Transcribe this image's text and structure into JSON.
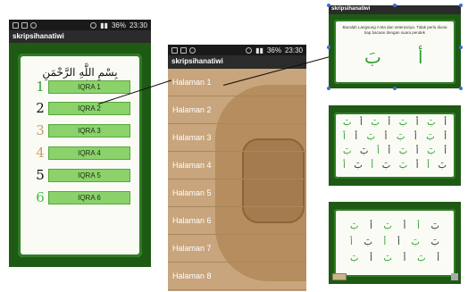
{
  "statusbar": {
    "battery": "36%",
    "time": "23:30"
  },
  "app_title": "skripsihanatiwi",
  "phone1": {
    "basmala": "بِسْمِ اللَّهِ الرَّحْمَنِ الرَّحِيمِ",
    "items": [
      {
        "num": "1",
        "label": "IQRA 1",
        "color": "#2f9e2f"
      },
      {
        "num": "2",
        "label": "IQRA 2",
        "color": "#111111"
      },
      {
        "num": "3",
        "label": "IQRA 3",
        "color": "#c8a066"
      },
      {
        "num": "4",
        "label": "IQRA 4",
        "color": "#c8a066"
      },
      {
        "num": "5",
        "label": "IQRA 5",
        "color": "#111111"
      },
      {
        "num": "6",
        "label": "IQRA 6",
        "color": "#3fbf3f"
      }
    ]
  },
  "phone2": {
    "items": [
      "Halaman 1",
      "Halaman 2",
      "Halaman 3",
      "Halaman 4",
      "Halaman 5",
      "Halaman 6",
      "Halaman 7",
      "Halaman 8"
    ]
  },
  "panel1": {
    "instruction": "Bacalah Langsung A-Ba dan seterusnya. Tidak perlu diurai tiap bacaan dengan suara pendek",
    "letters": [
      "بَ",
      "أ"
    ]
  },
  "panel2": {
    "rows": [
      [
        "بَ",
        "أ",
        "بَ",
        "أ",
        "بَ",
        "أ",
        "بَ",
        "أ"
      ],
      [
        "أ",
        "أ",
        "بَ",
        "أ",
        "بَ",
        "أ",
        "بَ",
        "أ"
      ],
      [
        "بَ",
        "بَ",
        "أ",
        "أ",
        "بَ",
        "أ",
        "بَ",
        "أ"
      ],
      [
        "أ",
        "بَ",
        "أ",
        "بَ",
        "بَ",
        "أ",
        "أ",
        "بَ"
      ]
    ]
  },
  "panel3": {
    "rows": [
      [
        "بَ",
        "أ",
        "بَ",
        "أ",
        "أ",
        "بَ"
      ],
      [
        "أ",
        "بَ",
        "أ",
        "أ",
        "بَ",
        "بَ"
      ],
      [
        "بَ",
        "أ",
        "بَ",
        "أ",
        "بَ",
        "أ"
      ]
    ]
  }
}
